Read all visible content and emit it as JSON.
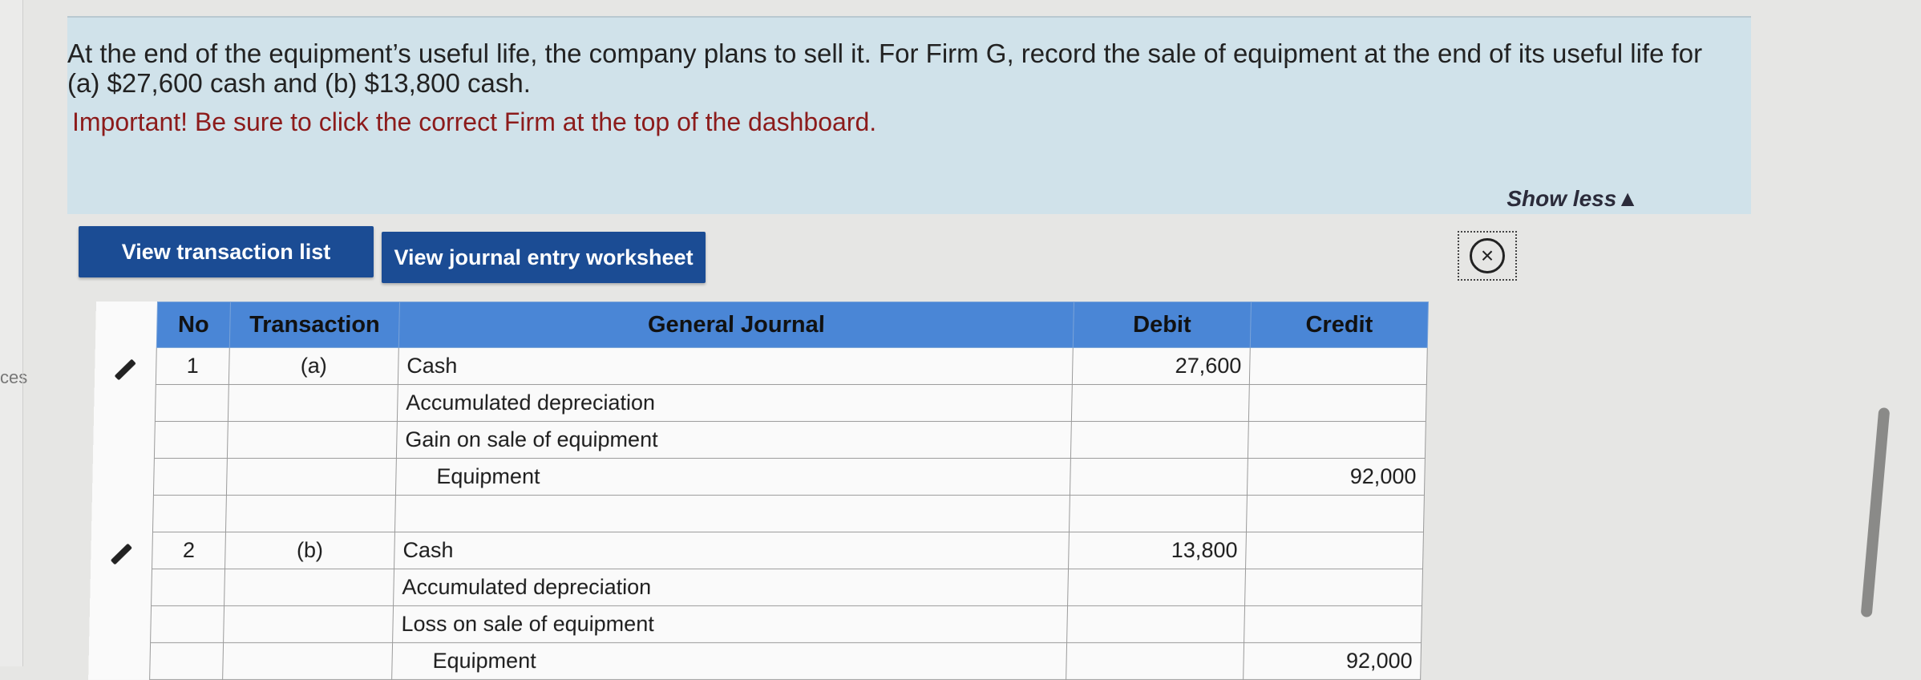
{
  "left_fragment": "ces",
  "instruction": {
    "text": "At the end of the equipment’s useful life, the company plans to sell it. For Firm G, record the sale of equipment at the end of its useful life for (a) $27,600 cash and (b) $13,800 cash.",
    "important": "Important! Be sure to click the correct Firm at the top of the dashboard.",
    "show_less": "Show less▲"
  },
  "buttons": {
    "transaction_list": "View transaction list",
    "journal_worksheet": "View journal entry worksheet"
  },
  "table": {
    "headers": [
      "No",
      "Transaction",
      "General Journal",
      "Debit",
      "Credit"
    ],
    "rows": [
      {
        "no": "1",
        "transaction": "(a)",
        "account": "Cash",
        "debit": "27,600",
        "credit": ""
      },
      {
        "no": "",
        "transaction": "",
        "account": "Accumulated depreciation",
        "debit": "",
        "credit": ""
      },
      {
        "no": "",
        "transaction": "",
        "account": "Gain on sale of equipment",
        "debit": "",
        "credit": ""
      },
      {
        "no": "",
        "transaction": "",
        "account": "Equipment",
        "debit": "",
        "credit": "92,000"
      },
      {
        "no": "",
        "transaction": "",
        "account": "",
        "debit": "",
        "credit": ""
      },
      {
        "no": "2",
        "transaction": "(b)",
        "account": "Cash",
        "debit": "13,800",
        "credit": ""
      },
      {
        "no": "",
        "transaction": "",
        "account": "Accumulated depreciation",
        "debit": "",
        "credit": ""
      },
      {
        "no": "",
        "transaction": "",
        "account": "Loss on sale of equipment",
        "debit": "",
        "credit": ""
      },
      {
        "no": "",
        "transaction": "",
        "account": "Equipment",
        "debit": "",
        "credit": "92,000"
      }
    ]
  },
  "colors": {
    "instruction_bg": "#d0e2ea",
    "button_bg": "#1b4c94",
    "header_bg": "#4a86d6",
    "important_text": "#8c1b1b"
  },
  "icons": [
    "pencil-icon",
    "close-icon"
  ]
}
